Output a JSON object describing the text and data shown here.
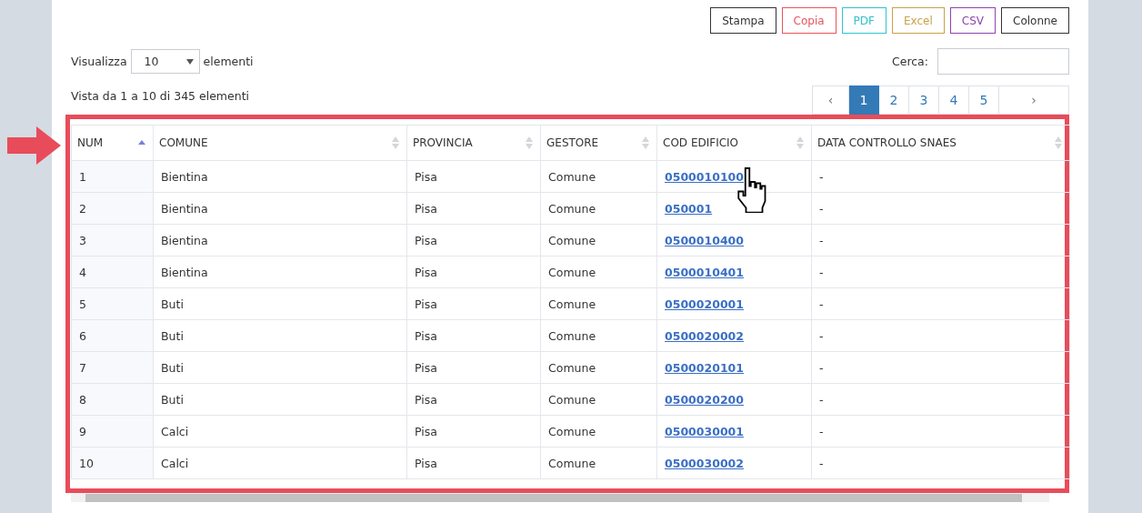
{
  "export_buttons": [
    {
      "label": "Stampa",
      "color": "#333333"
    },
    {
      "label": "Copia",
      "color": "#e8545f"
    },
    {
      "label": "PDF",
      "color": "#2fc3cf"
    },
    {
      "label": "Excel",
      "color": "#c9a24a"
    },
    {
      "label": "CSV",
      "color": "#8e44ad"
    },
    {
      "label": "Colonne",
      "color": "#333333"
    }
  ],
  "length_menu": {
    "label_before": "Visualizza",
    "value": "10",
    "label_after": "elementi"
  },
  "search": {
    "label": "Cerca:"
  },
  "info": "Vista da 1 a 10 di 345 elementi",
  "pagination": [
    {
      "label": "‹",
      "selected": false
    },
    {
      "label": "1",
      "selected": true
    },
    {
      "label": "2",
      "selected": false
    },
    {
      "label": "3",
      "selected": false
    },
    {
      "label": "4",
      "selected": false
    },
    {
      "label": "5",
      "selected": false
    },
    {
      "label": "›",
      "selected": false
    }
  ],
  "table": {
    "columns": [
      {
        "label": "NUM",
        "sorted": true,
        "kind": "text"
      },
      {
        "label": "COMUNE",
        "sorted": false,
        "kind": "text"
      },
      {
        "label": "PROVINCIA",
        "sorted": false,
        "kind": "text"
      },
      {
        "label": "GESTORE",
        "sorted": false,
        "kind": "text"
      },
      {
        "label": "COD EDIFICIO",
        "sorted": false,
        "kind": "link"
      },
      {
        "label": "DATA CONTROLLO SNAES",
        "sorted": false,
        "kind": "text"
      }
    ],
    "rows": [
      [
        "1",
        "Bientina",
        "Pisa",
        "Comune",
        "0500010100",
        "-"
      ],
      [
        "2",
        "Bientina",
        "Pisa",
        "Comune",
        "050001",
        "-"
      ],
      [
        "3",
        "Bientina",
        "Pisa",
        "Comune",
        "0500010400",
        "-"
      ],
      [
        "4",
        "Bientina",
        "Pisa",
        "Comune",
        "0500010401",
        "-"
      ],
      [
        "5",
        "Buti",
        "Pisa",
        "Comune",
        "0500020001",
        "-"
      ],
      [
        "6",
        "Buti",
        "Pisa",
        "Comune",
        "0500020002",
        "-"
      ],
      [
        "7",
        "Buti",
        "Pisa",
        "Comune",
        "0500020101",
        "-"
      ],
      [
        "8",
        "Buti",
        "Pisa",
        "Comune",
        "0500020200",
        "-"
      ],
      [
        "9",
        "Calci",
        "Pisa",
        "Comune",
        "0500030001",
        "-"
      ],
      [
        "10",
        "Calci",
        "Pisa",
        "Comune",
        "0500030002",
        "-"
      ]
    ]
  }
}
